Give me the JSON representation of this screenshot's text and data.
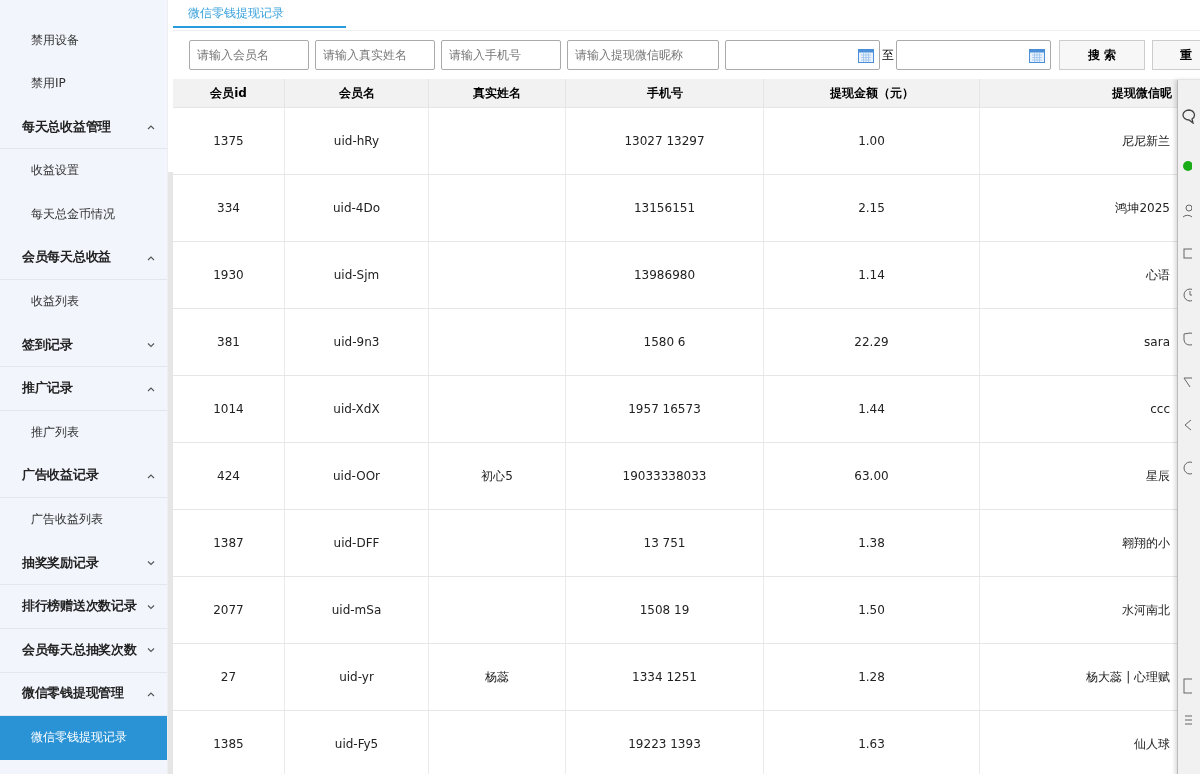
{
  "sidebar": {
    "items": [
      {
        "kind": "link",
        "label": "禁用设备",
        "selected": false
      },
      {
        "kind": "link",
        "label": "禁用IP",
        "selected": false
      },
      {
        "kind": "group",
        "label": "每天总收益管理",
        "expanded": true,
        "children": [
          {
            "label": "收益设置",
            "selected": false
          },
          {
            "label": "每天总金币情况",
            "selected": false
          }
        ]
      },
      {
        "kind": "group",
        "label": "会员每天总收益",
        "expanded": true,
        "children": [
          {
            "label": "收益列表",
            "selected": false
          }
        ]
      },
      {
        "kind": "group",
        "label": "签到记录",
        "expanded": false
      },
      {
        "kind": "group",
        "label": "推广记录",
        "expanded": true,
        "children": [
          {
            "label": "推广列表",
            "selected": false
          }
        ]
      },
      {
        "kind": "group",
        "label": "广告收益记录",
        "expanded": true,
        "children": [
          {
            "label": "广告收益列表",
            "selected": false
          }
        ]
      },
      {
        "kind": "group",
        "label": "抽奖奖励记录",
        "expanded": false
      },
      {
        "kind": "group",
        "label": "排行榜赠送次数记录",
        "expanded": false
      },
      {
        "kind": "group",
        "label": "会员每天总抽奖次数",
        "expanded": false
      },
      {
        "kind": "group",
        "label": "微信零钱提现管理",
        "expanded": true,
        "children": [
          {
            "label": "微信零钱提现记录",
            "selected": true
          }
        ]
      }
    ]
  },
  "tabs": [
    {
      "label": "微信零钱提现记录",
      "selected": true
    }
  ],
  "filters": {
    "fields": [
      {
        "placeholder": "请输入会员名"
      },
      {
        "placeholder": "请输入真实姓名"
      },
      {
        "placeholder": "请输入手机号"
      },
      {
        "placeholder": "请输入提现微信昵称"
      }
    ],
    "date_separator": "至",
    "buttons": [
      "搜 索",
      "重"
    ]
  },
  "table": {
    "columns": [
      "会员id",
      "会员名",
      "真实姓名",
      "手机号",
      "提现金额（元）",
      "提现微信昵"
    ],
    "rows": [
      [
        "1375",
        "uid-hRy",
        "",
        "13027 13297",
        "1.00",
        "尼尼新兰"
      ],
      [
        "334",
        "uid-4Do",
        "",
        "13156151",
        "2.15",
        "鸿坤2025"
      ],
      [
        "1930",
        "uid-Sjm",
        "",
        "13986980",
        "1.14",
        "心语"
      ],
      [
        "381",
        "uid-9n3",
        "",
        "1580 6",
        "22.29",
        "sara"
      ],
      [
        "1014",
        "uid-XdX",
        "",
        "1957 16573",
        "1.44",
        "ccc"
      ],
      [
        "424",
        "uid-OOr",
        "初心5",
        "19033338033",
        "63.00",
        "星辰"
      ],
      [
        "1387",
        "uid-DFF",
        "",
        "13 751",
        "1.38",
        "翱翔的小"
      ],
      [
        "2077",
        "uid-mSa",
        "",
        "1508 19",
        "1.50",
        "水河南北"
      ],
      [
        "27",
        "uid-yr",
        "杨蕊",
        "1334 1251",
        "1.28",
        "杨大蕊 | 心理赋"
      ],
      [
        "1385",
        "uid-Fy5",
        "",
        "19223 1393",
        "1.63",
        "仙人球"
      ]
    ]
  }
}
